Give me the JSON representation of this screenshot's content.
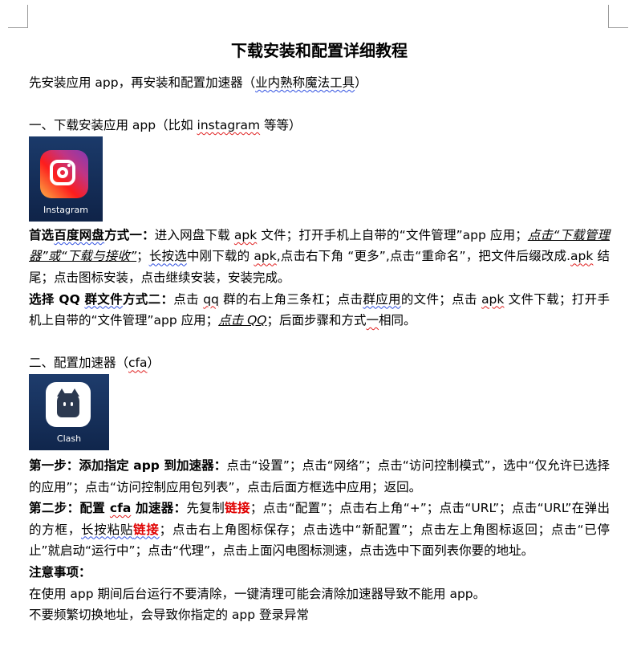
{
  "title": "下载安装和配置详细教程",
  "intro": {
    "a": "先安装应用 app，再安装和配置加速器（",
    "b": "业内熟称魔法工具",
    "c": "）"
  },
  "section1": {
    "heading": {
      "a": "一、下载安装应用 app（比如 ",
      "b": "instagram",
      "c": " 等等）"
    },
    "icon_label": "Instagram",
    "p1": {
      "bold1": "首选",
      "bold2": "百度网盘",
      "bold3": "方式一：",
      "t1": "进入网盘下载 ",
      "apk1": "apk",
      "t2": " 文件；打开手机上自带的“文件管理”app 应用；",
      "italic": "点击“下载管理器”或“下载与接收”",
      "t3": "；",
      "long": "长按选",
      "t4": "中刚下载的 ",
      "apk2": "apk",
      "t5": ",点击右下角 “更多”,点击“重命名”，把文件后缀改成.",
      "apk3": "apk",
      "t6": " 结尾；点击图标安装，点击继续安装，安装完成。"
    },
    "p2": {
      "bold1": "选择 QQ ",
      "bold2": "群文件",
      "bold3": "方式二：",
      "t1": "点击 ",
      "qq": "qq",
      "t2": " 群的右上角三条杠；点击",
      "grp": "群应用",
      "t3": "的文件；点击 ",
      "apk": "apk",
      "t4": " 文件下载；打开手机上自带的“文件管理”app 应用；",
      "italic": "点击 QQ",
      "t5": "；后面步骤和方式",
      "one": "一",
      "t6": "相同。"
    }
  },
  "section2": {
    "heading": {
      "a": "二、配置加速器（",
      "b": "cfa",
      "c": "）"
    },
    "icon_label": "Clash",
    "step1": {
      "bold": "第一步：添加指定 app 到加速器：",
      "text": "点击“设置”；点击“网络”；点击“访问控制模式”，选中“仅允许已选择的应用”；点击“访问控制应用包列表”，点击后面方框选中应用；返回。"
    },
    "step2": {
      "bold1": "第二步：配置 ",
      "cfa": "cfa",
      "bold2": " 加速器：",
      "t1": "先复制",
      "link1": "链接",
      "t2": "；点击“配置”；点击右上角“+”；点击“URL”；点击“URL”在弹出的方框，",
      "paste": "长按粘贴",
      "link2": "链接",
      "t3": "；点击右上角图标保存；点击选中“新配置”；点击左上角图标返回；点击“已停止”就启动“运行中”；点击“代理”，点击上面闪电图标测速，点击选中下面列表你要的地址。"
    },
    "notes_title": "注意事项：",
    "note1": "在使用 app 期间后台运行不要清除，一键清理可能会清除加速器导致不能用 app。",
    "note2": "不要频繁切换地址，会导致你指定的 app 登录异常"
  },
  "colors": {
    "link_red": "#e00000"
  }
}
